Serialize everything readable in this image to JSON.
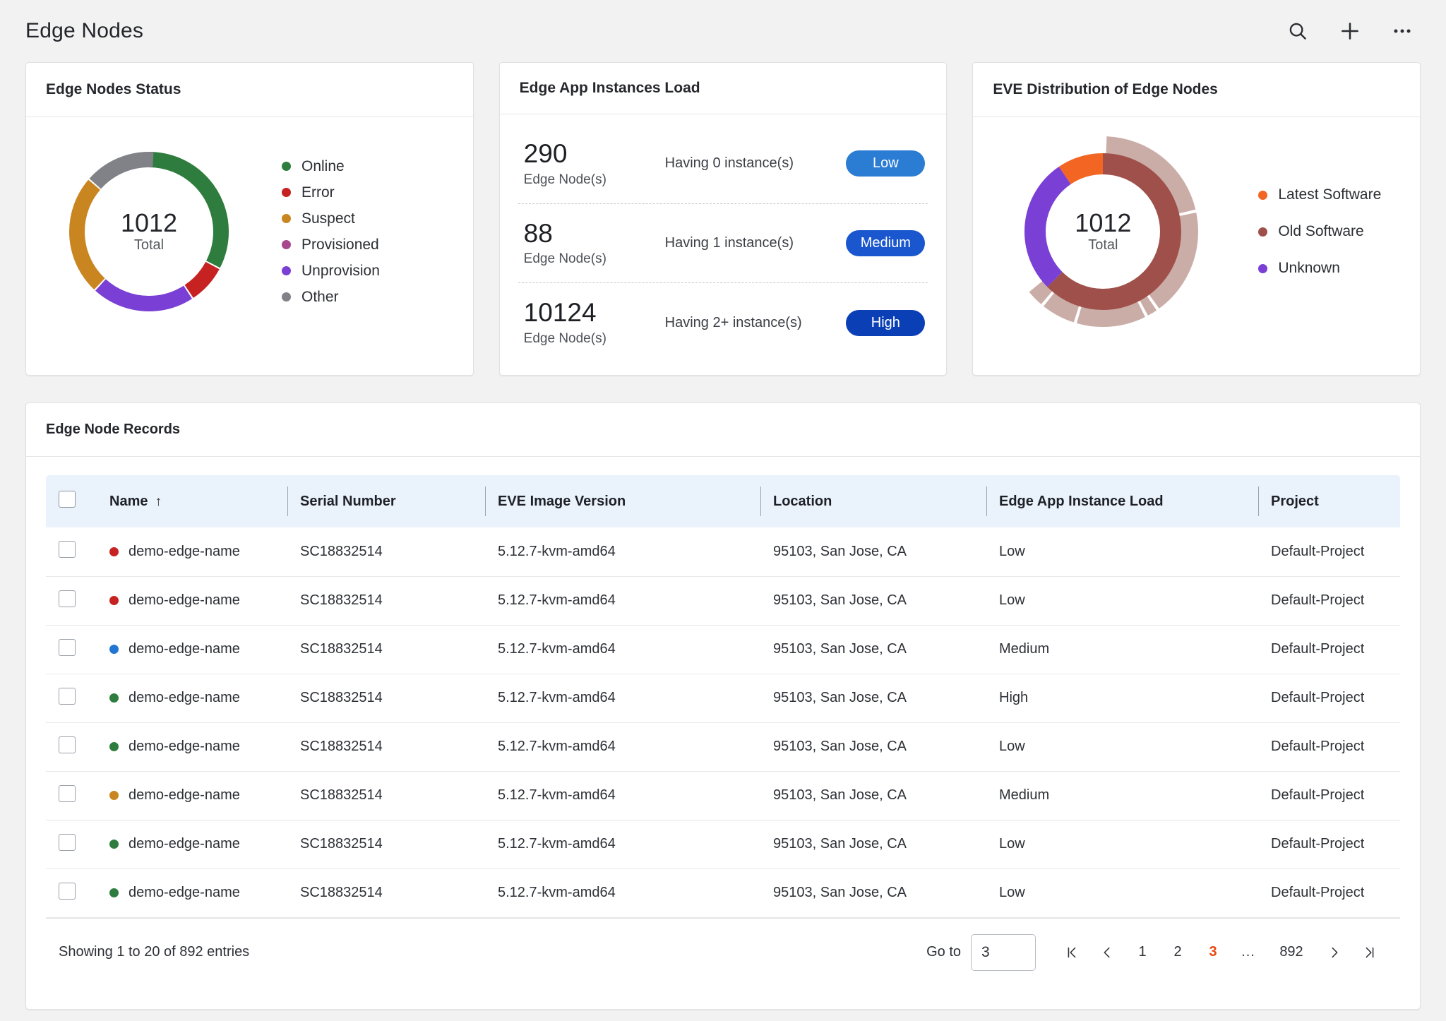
{
  "header": {
    "title": "Edge Nodes",
    "actions": [
      {
        "name": "search-icon",
        "label": "Search"
      },
      {
        "name": "add-icon",
        "label": "Add"
      },
      {
        "name": "more-icon",
        "label": "More options"
      }
    ]
  },
  "status_card": {
    "title": "Edge Nodes Status",
    "total_value": "1012",
    "total_label": "Total",
    "legend": [
      {
        "label": "Online",
        "color": "#2E7D3E"
      },
      {
        "label": "Error",
        "color": "#C62222"
      },
      {
        "label": "Suspect",
        "color": "#C98620"
      },
      {
        "label": "Provisioned",
        "color": "#A8478C"
      },
      {
        "label": "Unprovision",
        "color": "#7A3FD4"
      },
      {
        "label": "Other",
        "color": "#808287"
      }
    ]
  },
  "load_card": {
    "title": "Edge App Instances Load",
    "rows": [
      {
        "count": "290",
        "unit": "Edge Node(s)",
        "description": "Having 0 instance(s)",
        "badge": "Low",
        "badge_color": "#2B7CD3"
      },
      {
        "count": "88",
        "unit": "Edge Node(s)",
        "description": "Having 1 instance(s)",
        "badge": "Medium",
        "badge_color": "#1A56CE"
      },
      {
        "count": "10124",
        "unit": "Edge Node(s)",
        "description": "Having 2+ instance(s)",
        "badge": "High",
        "badge_color": "#0B3FB5"
      }
    ]
  },
  "eve_card": {
    "title": "EVE Distribution of Edge Nodes",
    "total_value": "1012",
    "total_label": "Total",
    "legend": [
      {
        "label": "Latest Software",
        "color": "#F26522"
      },
      {
        "label": "Old Software",
        "color": "#A0504A"
      },
      {
        "label": "Unknown",
        "color": "#7A3FD4"
      }
    ]
  },
  "records": {
    "title": "Edge Node Records",
    "columns": [
      {
        "key": "name",
        "label": "Name",
        "sort": "↑"
      },
      {
        "key": "serial",
        "label": "Serial Number",
        "sort": ""
      },
      {
        "key": "eve",
        "label": "EVE Image Version",
        "sort": ""
      },
      {
        "key": "location",
        "label": "Location",
        "sort": ""
      },
      {
        "key": "load",
        "label": "Edge App Instance Load",
        "sort": ""
      },
      {
        "key": "project",
        "label": "Project",
        "sort": ""
      }
    ],
    "rows": [
      {
        "status_color": "#C62222",
        "name": "demo-edge-name",
        "serial": "SC18832514",
        "eve": "5.12.7-kvm-amd64",
        "location": "95103, San Jose, CA",
        "load": "Low",
        "project": "Default-Project"
      },
      {
        "status_color": "#C62222",
        "name": "demo-edge-name",
        "serial": "SC18832514",
        "eve": "5.12.7-kvm-amd64",
        "location": "95103, San Jose, CA",
        "load": "Low",
        "project": "Default-Project"
      },
      {
        "status_color": "#2176D2",
        "name": "demo-edge-name",
        "serial": "SC18832514",
        "eve": "5.12.7-kvm-amd64",
        "location": "95103, San Jose, CA",
        "load": "Medium",
        "project": "Default-Project"
      },
      {
        "status_color": "#2E7D3E",
        "name": "demo-edge-name",
        "serial": "SC18832514",
        "eve": "5.12.7-kvm-amd64",
        "location": "95103, San Jose, CA",
        "load": "High",
        "project": "Default-Project"
      },
      {
        "status_color": "#2E7D3E",
        "name": "demo-edge-name",
        "serial": "SC18832514",
        "eve": "5.12.7-kvm-amd64",
        "location": "95103, San Jose, CA",
        "load": "Low",
        "project": "Default-Project"
      },
      {
        "status_color": "#C98620",
        "name": "demo-edge-name",
        "serial": "SC18832514",
        "eve": "5.12.7-kvm-amd64",
        "location": "95103, San Jose, CA",
        "load": "Medium",
        "project": "Default-Project"
      },
      {
        "status_color": "#2E7D3E",
        "name": "demo-edge-name",
        "serial": "SC18832514",
        "eve": "5.12.7-kvm-amd64",
        "location": "95103, San Jose, CA",
        "load": "Low",
        "project": "Default-Project"
      },
      {
        "status_color": "#2E7D3E",
        "name": "demo-edge-name",
        "serial": "SC18832514",
        "eve": "5.12.7-kvm-amd64",
        "location": "95103, San Jose, CA",
        "load": "Low",
        "project": "Default-Project"
      }
    ],
    "footer": {
      "showing": "Showing 1 to 20 of 892 entries",
      "goto_label": "Go to",
      "goto_value": "3",
      "pages": [
        "1",
        "2",
        "3",
        "...",
        "892"
      ],
      "active_page": "3",
      "active_color": "#E8490F"
    }
  },
  "chart_data": [
    {
      "type": "pie",
      "title": "Edge Nodes Status",
      "center_value": 1012,
      "center_label": "Total",
      "categories": [
        "Online",
        "Error",
        "Suspect",
        "Provisioned",
        "Unprovision",
        "Other"
      ],
      "values": [
        32.5,
        7.8,
        24.2,
        0,
        20.8,
        14.7
      ],
      "colors": [
        "#2E7D3E",
        "#C62222",
        "#C98620",
        "#A8478C",
        "#7A3FD4",
        "#808287"
      ],
      "legend_position": "right",
      "donut": true
    },
    {
      "type": "pie",
      "title": "EVE Distribution of Edge Nodes",
      "center_value": 1012,
      "center_label": "Total",
      "categories": [
        "Latest Software",
        "Old Software",
        "Unknown"
      ],
      "values": [
        9.5,
        62.5,
        28.0
      ],
      "colors": [
        "#F26522",
        "#A0504A",
        "#7A3FD4"
      ],
      "outer_ring": {
        "label": "Old Software versions",
        "values": [
          21.0,
          18.5,
          2.0,
          12.0,
          6.0,
          3.0
        ],
        "color": "#CBADA8"
      },
      "legend_position": "right",
      "donut": true
    }
  ]
}
